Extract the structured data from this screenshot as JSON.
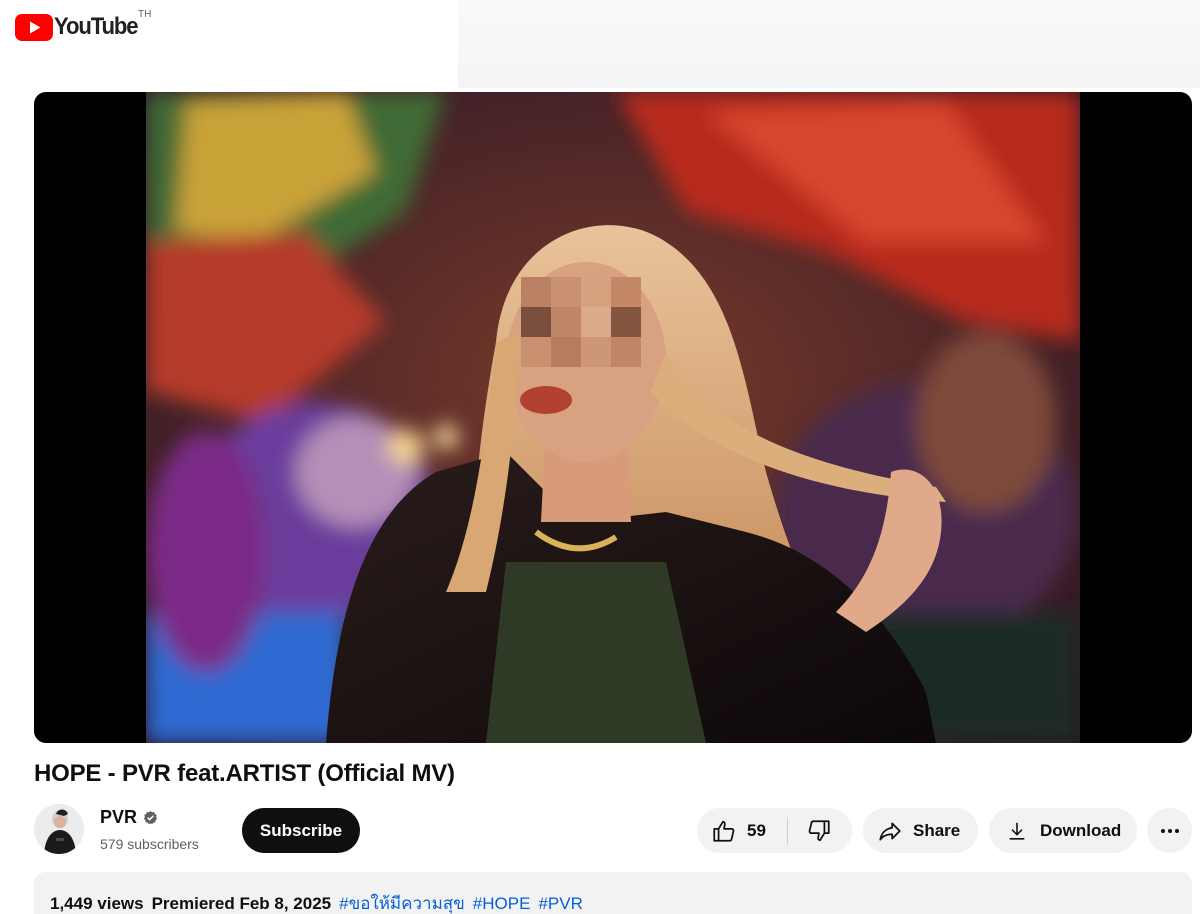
{
  "header": {
    "logo_text": "YouTube",
    "country_code": "TH"
  },
  "video": {
    "title": "HOPE - PVR feat.ARTIST (Official MV)"
  },
  "channel": {
    "name": "PVR",
    "subscribers": "579 subscribers",
    "subscribe_label": "Subscribe"
  },
  "actions": {
    "like_count": "59",
    "share_label": "Share",
    "download_label": "Download"
  },
  "description": {
    "views": "1,449 views",
    "premiered": "Premiered Feb 8, 2025",
    "hashtags": [
      "#ขอให้มีความสุข",
      "#HOPE",
      "#PVR"
    ]
  },
  "colors": {
    "brand_red": "#ff0000",
    "link_blue": "#065fd4",
    "button_dark": "#0f0f0f",
    "pill_bg": "#f2f2f2"
  },
  "icons": {
    "logo": "youtube-play-icon",
    "verified": "verified-check-icon",
    "like": "thumbs-up-icon",
    "dislike": "thumbs-down-icon",
    "share": "share-arrow-icon",
    "download": "download-icon",
    "more": "more-horizontal-icon"
  }
}
